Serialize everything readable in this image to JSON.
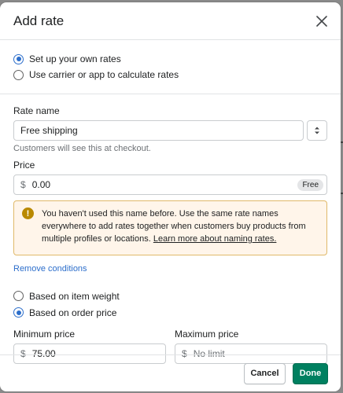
{
  "modal": {
    "title": "Add rate",
    "close_icon": "close-icon"
  },
  "rate_type": {
    "options": [
      {
        "label": "Set up your own rates",
        "checked": true
      },
      {
        "label": "Use carrier or app to calculate rates",
        "checked": false
      }
    ]
  },
  "rate_name": {
    "label": "Rate name",
    "value": "Free shipping",
    "help": "Customers will see this at checkout.",
    "stepper_icon": "up-down-chevron-icon"
  },
  "price": {
    "label": "Price",
    "currency": "$",
    "value": "0.00",
    "badge": "Free"
  },
  "banner": {
    "icon": "warning-icon",
    "text": "You haven't used this name before. Use the same rate names everywhere to add rates together when customers buy products from multiple profiles or locations.",
    "link": "Learn more about naming rates."
  },
  "conditions": {
    "remove_link": "Remove conditions",
    "options": [
      {
        "label": "Based on item weight",
        "checked": false
      },
      {
        "label": "Based on order price",
        "checked": true
      }
    ],
    "min_price": {
      "label": "Minimum price",
      "currency": "$",
      "value": "75.00"
    },
    "max_price": {
      "label": "Maximum price",
      "currency": "$",
      "placeholder": "No limit"
    }
  },
  "footer": {
    "cancel": "Cancel",
    "done": "Done"
  },
  "colors": {
    "accent": "#2c6ecb",
    "primary_button": "#008060",
    "banner_bg": "#fff5ea",
    "banner_border": "#e0b96a",
    "warning": "#b98900"
  }
}
